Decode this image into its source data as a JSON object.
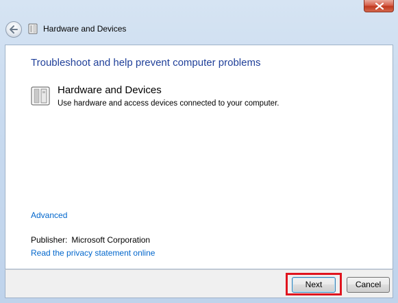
{
  "window": {
    "close_icon": "close-icon"
  },
  "header": {
    "back_icon": "back-arrow-icon",
    "icon": "hardware-devices-icon",
    "title": "Hardware and Devices"
  },
  "content": {
    "heading": "Troubleshoot and help prevent computer problems",
    "item": {
      "icon": "hardware-devices-icon",
      "title": "Hardware and Devices",
      "description": "Use hardware and access devices connected to your computer."
    },
    "advanced_link": "Advanced",
    "publisher_label": "Publisher:",
    "publisher_value": "Microsoft Corporation",
    "privacy_link": "Read the privacy statement online"
  },
  "footer": {
    "next_label": "Next",
    "cancel_label": "Cancel"
  },
  "colors": {
    "heading": "#1f3f99",
    "link": "#0066cc",
    "highlight": "#e0141e"
  }
}
